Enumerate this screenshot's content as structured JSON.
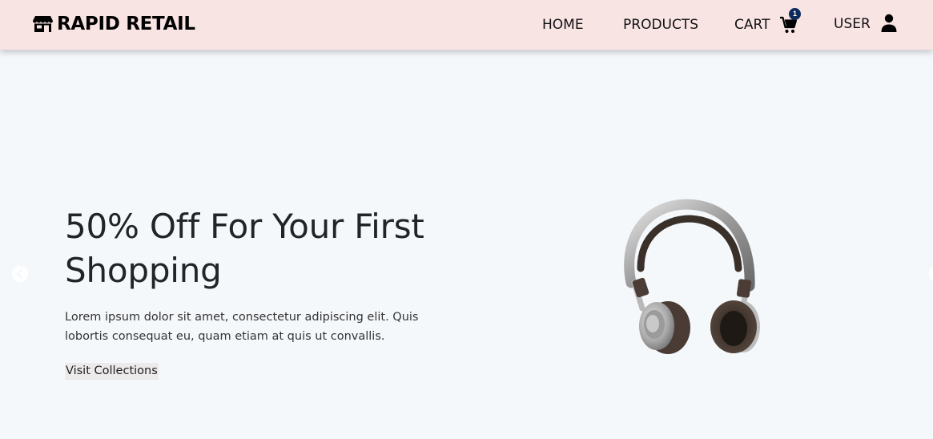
{
  "brand": {
    "name": "RAPID RETAIL",
    "icon": "store-icon"
  },
  "nav": {
    "home": "HOME",
    "products": "PRODUCTS",
    "cart": "CART",
    "cart_count": "1",
    "user": "USER"
  },
  "hero": {
    "title": "50% Off For Your First Shopping",
    "description": "Lorem ipsum dolor sit amet, consectetur adipiscing elit. Quis lobortis consequat eu, quam etiam at quis ut convallis.",
    "button": "Visit Collections",
    "image": "headphones"
  },
  "colors": {
    "navbar_bg": "#f9e4e4",
    "page_bg": "#f5f8fb",
    "badge": "#0d2a5c",
    "text": "#212529"
  }
}
